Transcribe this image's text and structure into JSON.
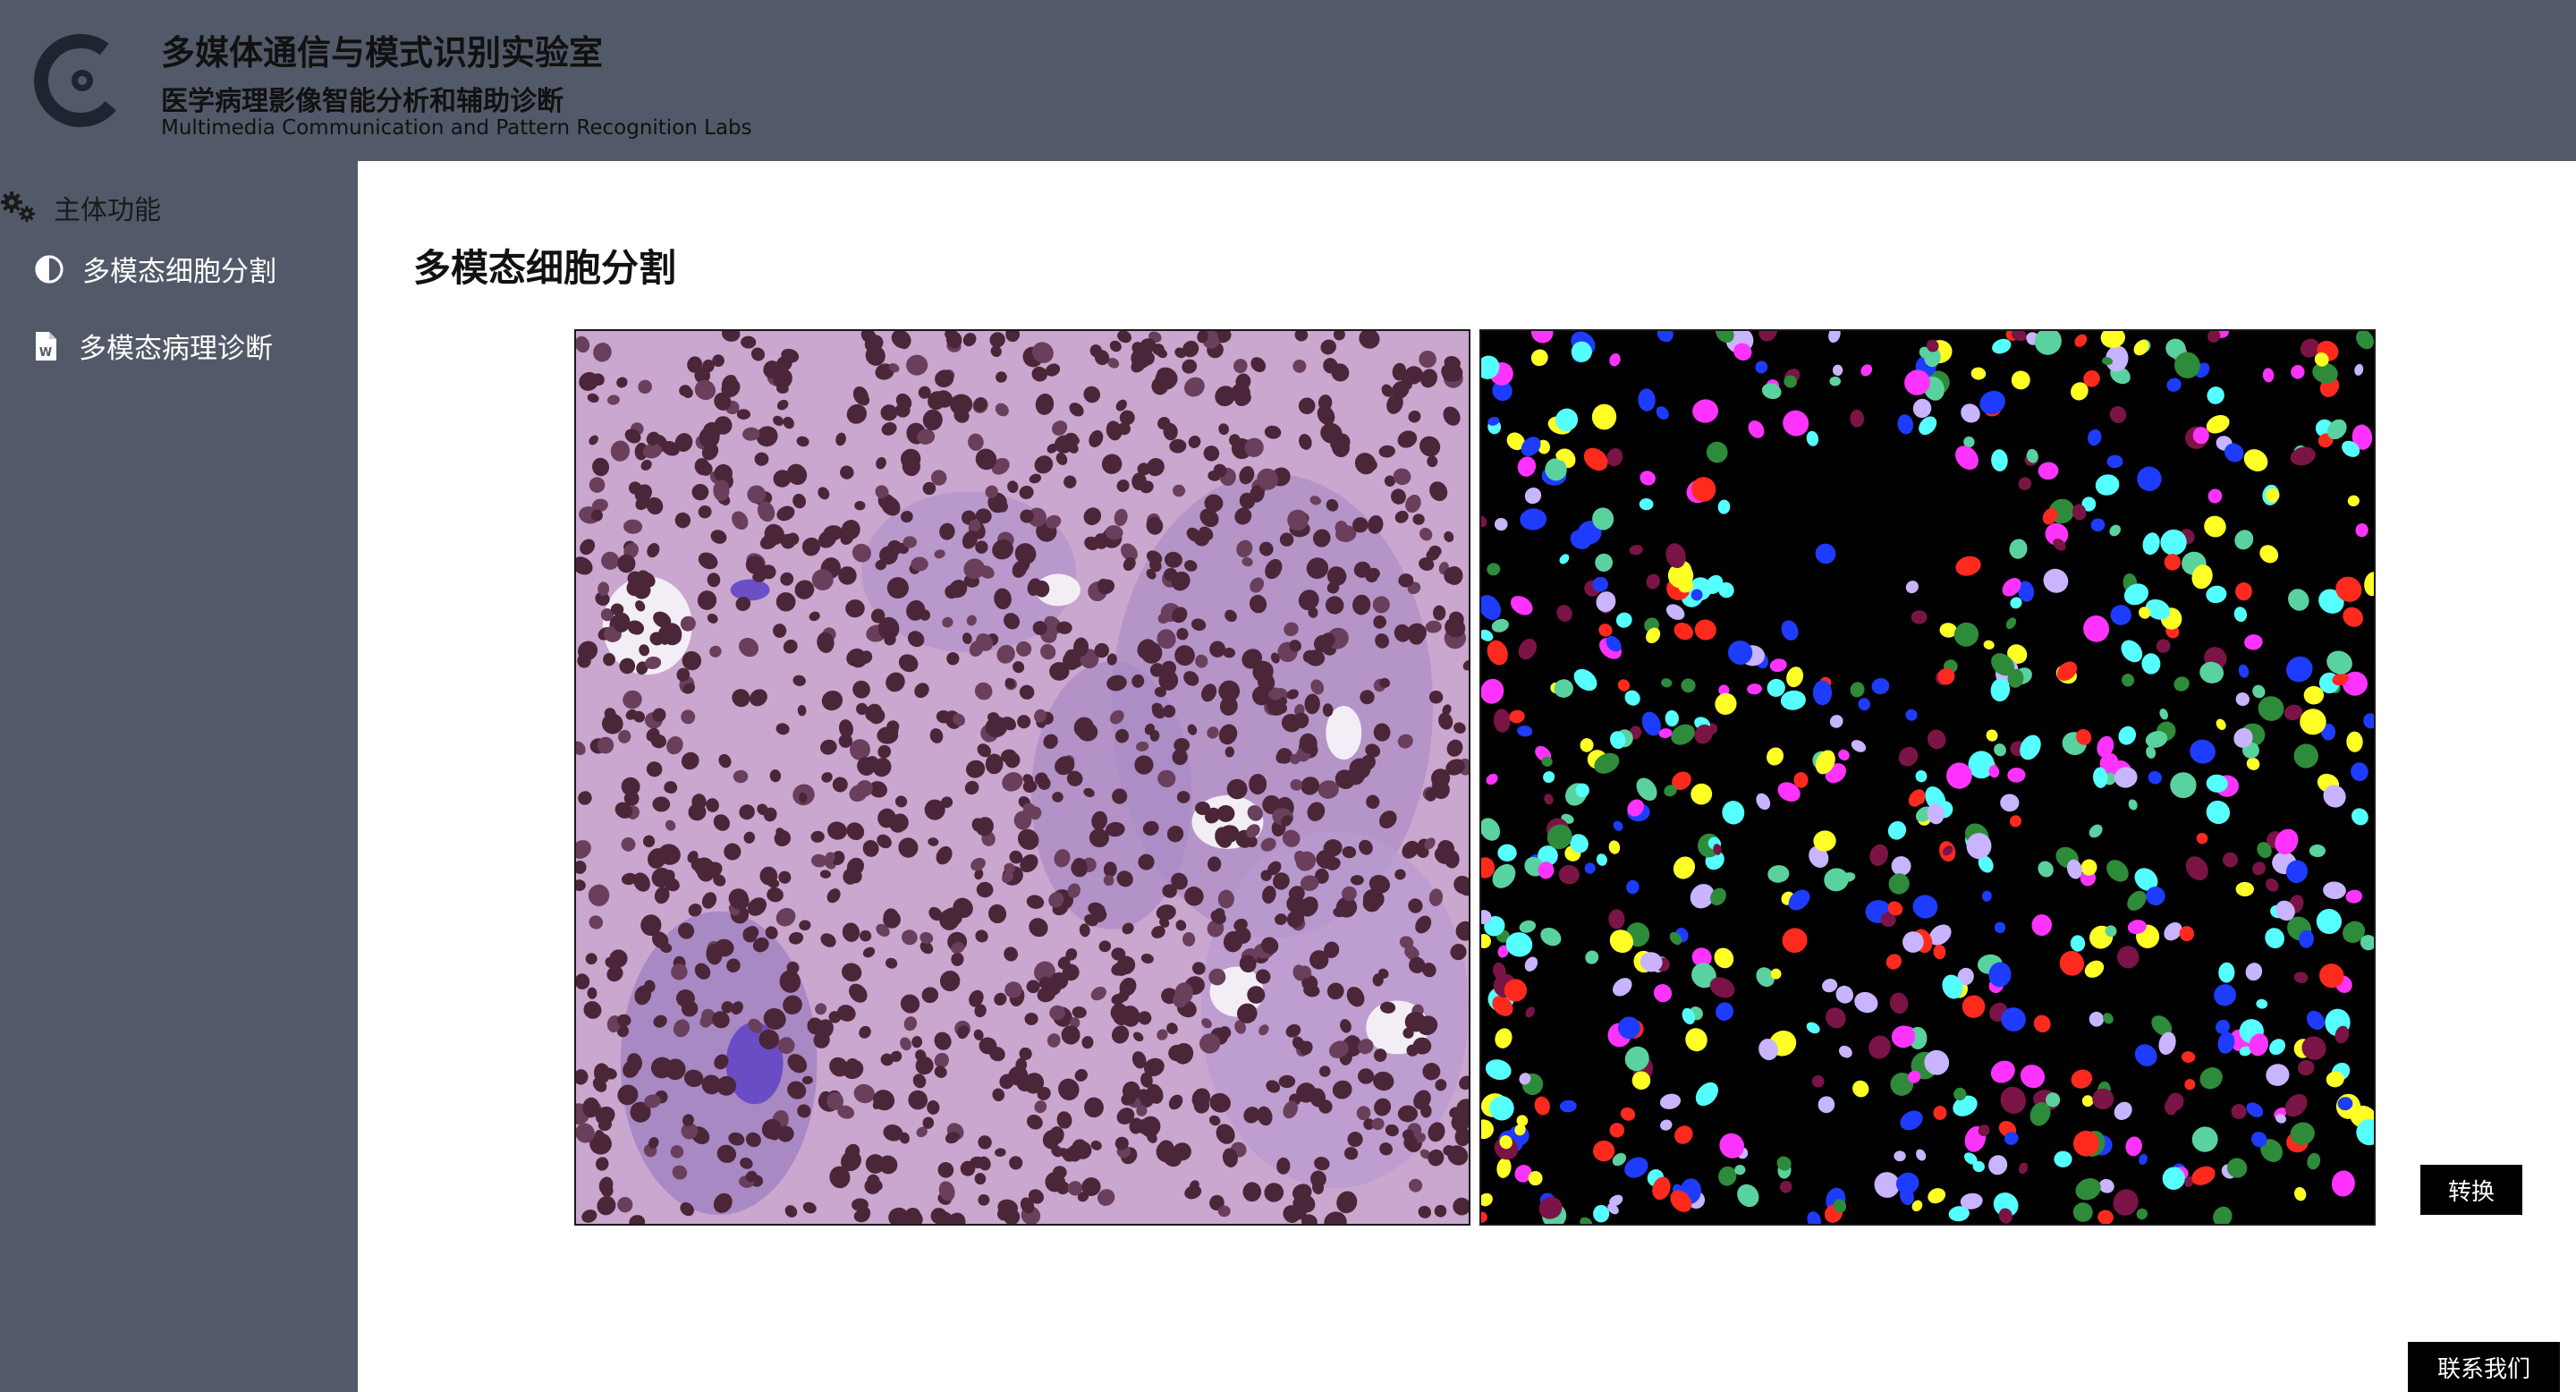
{
  "header": {
    "title": "多媒体通信与模式识别实验室",
    "subtitle": "医学病理影像智能分析和辅助诊断",
    "english_title": "Multimedia Communication and Pattern Recognition Labs",
    "logo_icon": "lab-logo-icon"
  },
  "sidebar": {
    "section_title": "主体功能",
    "section_icon": "gears-icon",
    "items": [
      {
        "label": "多模态细胞分割",
        "icon": "half-circle-icon"
      },
      {
        "label": "多模态病理诊断",
        "icon": "word-document-icon"
      }
    ]
  },
  "main": {
    "page_title": "多模态细胞分割",
    "images": [
      {
        "name": "original-histology-image",
        "description": "H&E stained tissue patch"
      },
      {
        "name": "segmentation-result-image",
        "description": "colored nuclei instance mask on black background"
      }
    ],
    "convert_button": "转换",
    "contact_button": "联系我们"
  },
  "colors": {
    "header_bg": "#525a69",
    "sidebar_bg": "#525a69",
    "content_bg": "#ffffff",
    "button_bg": "#000000",
    "tissue_bg": "#c9a7cf",
    "nucleus": "#4a2638",
    "mask_colors": [
      "#ff2a1e",
      "#ffff26",
      "#55ffff",
      "#1e3cff",
      "#ff33ff",
      "#2e8b3a",
      "#c8b4ff",
      "#7a1446",
      "#5ad2a0"
    ]
  }
}
